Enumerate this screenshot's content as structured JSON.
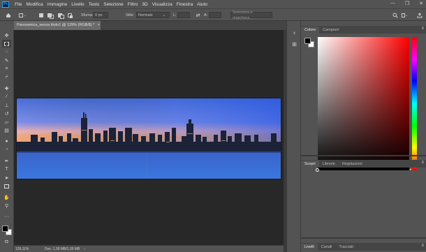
{
  "app": {
    "logo": "Ps",
    "menu": [
      "File",
      "Modifica",
      "Immagine",
      "Livello",
      "Testo",
      "Selezione",
      "Filtro",
      "3D",
      "Visualizza",
      "Finestra",
      "Aiuto"
    ],
    "window_controls": [
      "—",
      "❐",
      "✕"
    ]
  },
  "options_bar": {
    "feather_label": "Sfuma:",
    "feather_value": "0 px",
    "style_label": "Stile:",
    "style_value": "Normale",
    "width_label": "L:",
    "height_label": "A:",
    "select_mask_button": "Seleziona e maschera..."
  },
  "document": {
    "tab_title": "Panoramica_senza titolo1 @ 129% (RGB/8) *",
    "close_glyph": "×"
  },
  "status": {
    "zoom": "129,11%",
    "doc_size": "Doc: 1,39 MB/1,39 MB",
    "arrow": "›"
  },
  "color_panel": {
    "tabs": [
      "Colore",
      "Campioni"
    ],
    "menu_glyph": "≡",
    "foreground": "#000000",
    "background": "#ffffff",
    "hue": "#ff0000"
  },
  "learn_panel": {
    "tabs": [
      "Scopri",
      "Librerie",
      "Regolazioni"
    ],
    "menu_glyph": "≡"
  },
  "layers_panel": {
    "tabs": [
      "Livelli",
      "Canali",
      "Tracciati"
    ],
    "menu_glyph": "≡"
  },
  "tools": [
    "move-icon",
    "marquee-icon",
    "lasso-icon",
    "quick-select-icon",
    "crop-icon",
    "eyedropper-icon",
    "healing-icon",
    "brush-icon",
    "stamp-icon",
    "history-brush-icon",
    "eraser-icon",
    "gradient-icon",
    "blur-icon",
    "dodge-icon",
    "pen-icon",
    "type-icon",
    "path-select-icon",
    "rectangle-icon",
    "hand-icon",
    "zoom-icon",
    "more-icon"
  ]
}
